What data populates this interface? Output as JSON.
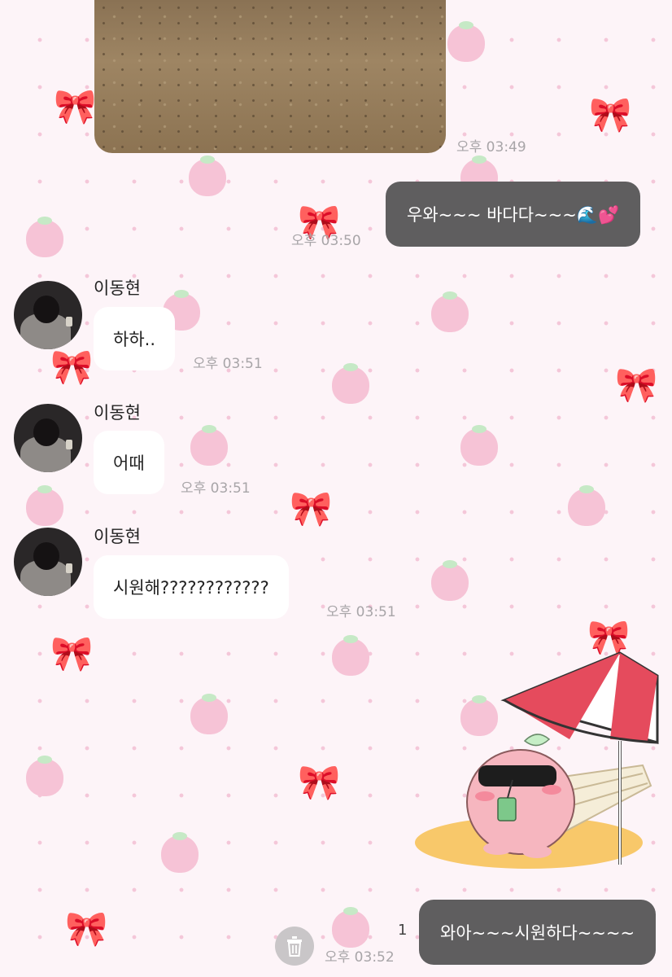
{
  "messages": [
    {
      "type": "image",
      "time": "오후 03:49"
    },
    {
      "type": "outgoing",
      "text": "우와~~~ 바다다~~~🌊💕",
      "time": "오후 03:50"
    },
    {
      "type": "incoming",
      "sender": "이동현",
      "text": "하하..",
      "time": "오후 03:51"
    },
    {
      "type": "incoming",
      "sender": "이동현",
      "text": "어때",
      "time": "오후 03:51"
    },
    {
      "type": "incoming",
      "sender": "이동현",
      "text": "시원해????????????",
      "time": "오후 03:51"
    },
    {
      "type": "sticker",
      "name": "peach-on-beach-chair-sticker"
    },
    {
      "type": "outgoing",
      "text": "와아~~~시원하다~~~~",
      "time": "오후 03:52",
      "unread_count": "1"
    }
  ],
  "icons": {
    "delete": "trash-icon"
  },
  "colors": {
    "outgoing_bubble": "#5f5e5f",
    "incoming_bubble": "#ffffff",
    "background": "#fdf4f8",
    "pattern_strawberry": "#f6c3d6"
  }
}
